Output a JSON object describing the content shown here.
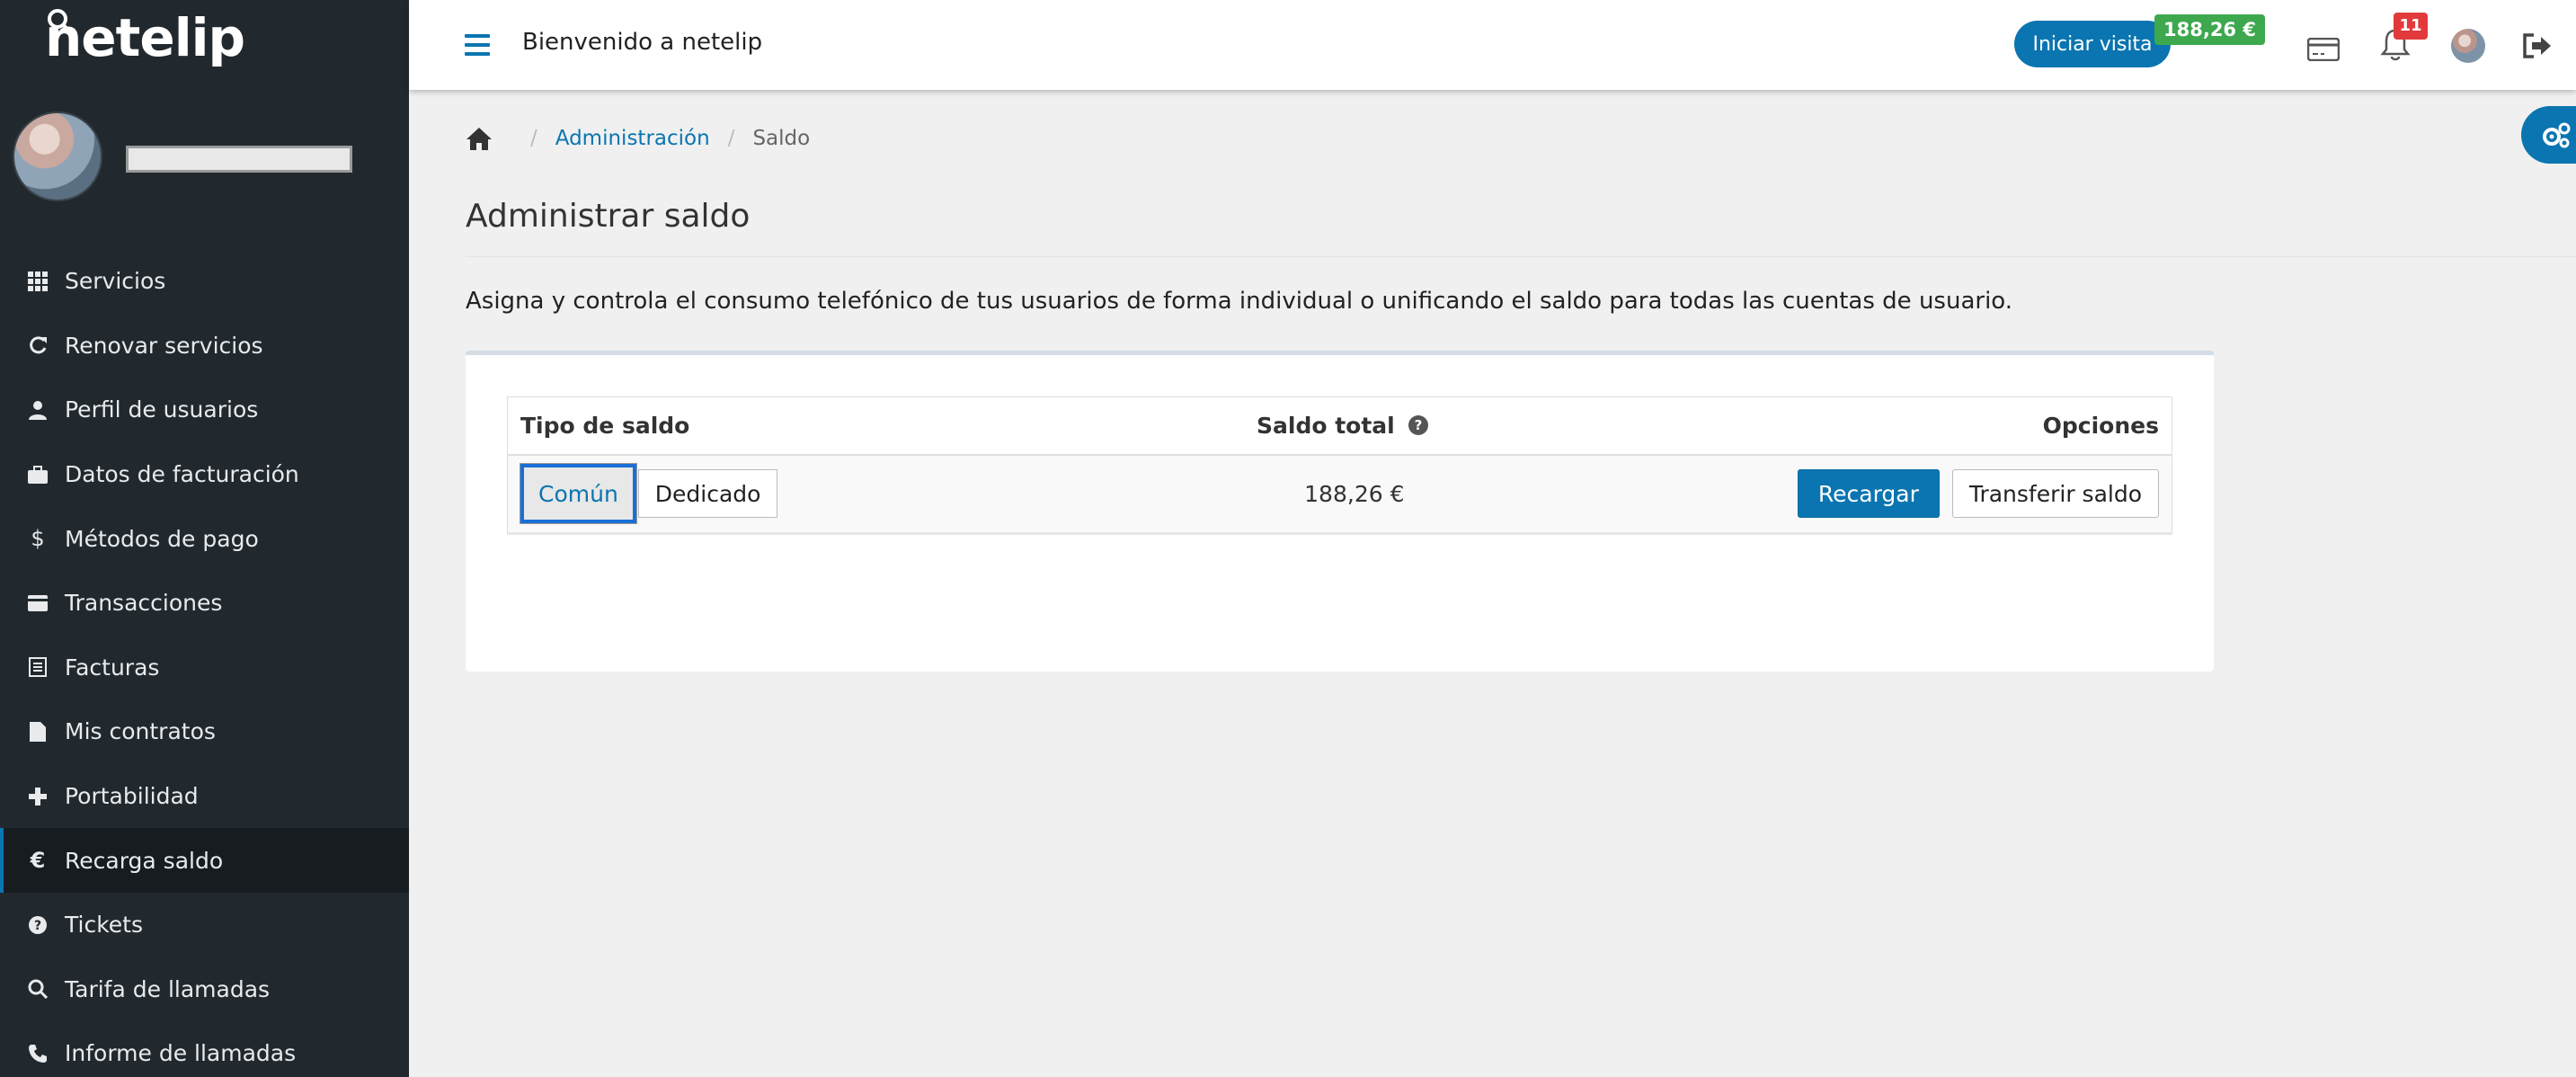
{
  "brand": {
    "logo_text": "netelip"
  },
  "sidebar": {
    "items": [
      {
        "label": "Servicios",
        "icon": "grid-icon",
        "active": false
      },
      {
        "label": "Renovar servicios",
        "icon": "refresh-icon",
        "active": false
      },
      {
        "label": "Perfil de usuarios",
        "icon": "user-icon",
        "active": false
      },
      {
        "label": "Datos de facturación",
        "icon": "briefcase-icon",
        "active": false
      },
      {
        "label": "Métodos de pago",
        "icon": "dollar-icon",
        "active": false
      },
      {
        "label": "Transacciones",
        "icon": "credit-card-icon",
        "active": false
      },
      {
        "label": "Facturas",
        "icon": "list-icon",
        "active": false
      },
      {
        "label": "Mis contratos",
        "icon": "file-icon",
        "active": false
      },
      {
        "label": "Portabilidad",
        "icon": "plus-icon",
        "active": false
      },
      {
        "label": "Recarga saldo",
        "icon": "euro-icon",
        "active": true
      },
      {
        "label": "Tickets",
        "icon": "question-circle-icon",
        "active": false
      },
      {
        "label": "Tarifa de llamadas",
        "icon": "search-icon",
        "active": false
      },
      {
        "label": "Informe de llamadas",
        "icon": "phone-icon",
        "active": false
      }
    ]
  },
  "topbar": {
    "welcome": "Bienvenido a netelip",
    "start_visit_label": "Iniciar visita",
    "balance_badge": "188,26 €",
    "notifications_count": "11"
  },
  "breadcrumb": {
    "admin": "Administración",
    "current": "Saldo"
  },
  "page": {
    "title": "Administrar saldo",
    "description": "Asigna y controla el consumo telefónico de tus usuarios de forma individual o unificando el saldo para todas las cuentas de usuario."
  },
  "table": {
    "headers": {
      "type": "Tipo de saldo",
      "total": "Saldo total",
      "options": "Opciones"
    },
    "row": {
      "type_options": [
        "Común",
        "Dedicado"
      ],
      "selected_type": "Común",
      "total": "188,26 €",
      "recharge_label": "Recargar",
      "transfer_label": "Transferir saldo"
    }
  },
  "colors": {
    "sidebar_bg": "#22292e",
    "accent": "#0a75b0",
    "balance_green": "#3ea84e",
    "notification_red": "#e23a3a"
  }
}
